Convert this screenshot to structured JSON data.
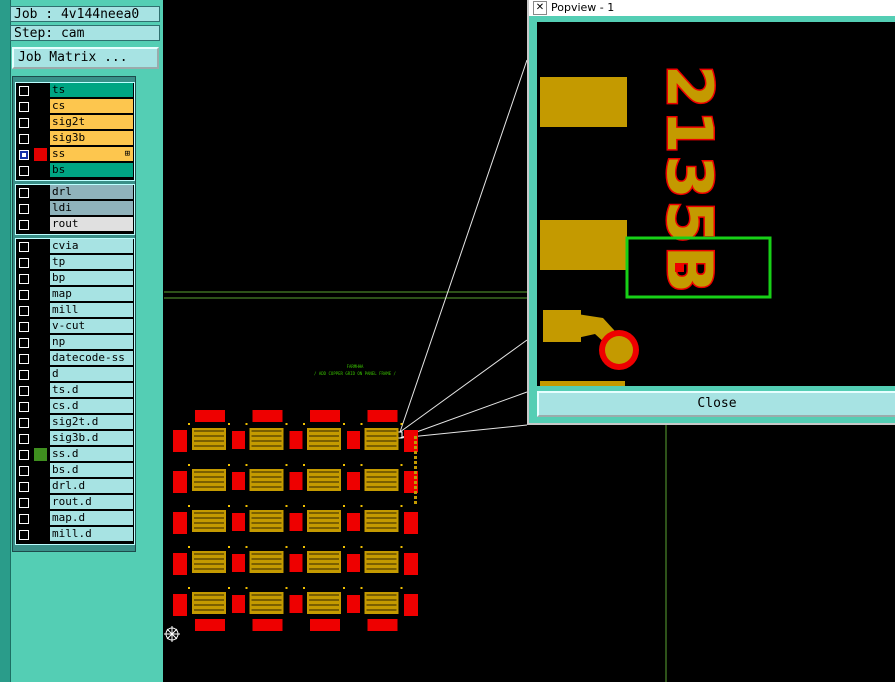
{
  "job_label": "Job : 4v144neea0",
  "step_label": "Step: cam",
  "job_matrix_button": "Job Matrix ...",
  "colors": {
    "panel": "#54ceb4",
    "row_bg": "#a7e3e3",
    "signal": "#fdc64e",
    "solder": "#00a583",
    "drill": "#8fb2bb",
    "selected_color": "#e40000",
    "copper": "#c49a00",
    "pad_red": "#ee0000",
    "green_box": "#17d017"
  },
  "layer_groups": [
    {
      "layers": [
        {
          "name": "ts",
          "type": "solder",
          "swatch": "",
          "checked": false
        },
        {
          "name": "cs",
          "type": "signal",
          "swatch": "",
          "checked": false
        },
        {
          "name": "sig2t",
          "type": "signal",
          "swatch": "",
          "checked": false
        },
        {
          "name": "sig3b",
          "type": "signal",
          "swatch": "",
          "checked": false
        },
        {
          "name": "ss",
          "type": "signal",
          "swatch": "#e40000",
          "checked": true,
          "marker": "⊞"
        },
        {
          "name": "bs",
          "type": "solder",
          "swatch": "",
          "checked": false
        }
      ]
    },
    {
      "layers": [
        {
          "name": "drl",
          "type": "drill",
          "swatch": "",
          "checked": false
        },
        {
          "name": "ldi",
          "type": "drill",
          "swatch": "",
          "checked": false
        },
        {
          "name": "rout",
          "type": "rout",
          "swatch": "",
          "checked": false
        }
      ]
    },
    {
      "layers": [
        {
          "name": "cvia",
          "type": "misc",
          "swatch": "",
          "checked": false
        },
        {
          "name": "tp",
          "type": "misc",
          "swatch": "",
          "checked": false
        },
        {
          "name": "bp",
          "type": "misc",
          "swatch": "",
          "checked": false
        },
        {
          "name": "map",
          "type": "misc",
          "swatch": "",
          "checked": false
        },
        {
          "name": "mill",
          "type": "misc",
          "swatch": "",
          "checked": false
        },
        {
          "name": "v-cut",
          "type": "misc",
          "swatch": "",
          "checked": false
        },
        {
          "name": "np",
          "type": "misc",
          "swatch": "",
          "checked": false
        },
        {
          "name": "datecode-ss",
          "type": "misc",
          "swatch": "",
          "checked": false
        },
        {
          "name": "d",
          "type": "misc",
          "swatch": "",
          "checked": false
        },
        {
          "name": "ts.d",
          "type": "misc",
          "swatch": "",
          "checked": false
        },
        {
          "name": "cs.d",
          "type": "misc",
          "swatch": "",
          "checked": false
        },
        {
          "name": "sig2t.d",
          "type": "misc",
          "swatch": "",
          "checked": false
        },
        {
          "name": "sig3b.d",
          "type": "misc",
          "swatch": "",
          "checked": false
        },
        {
          "name": "ss.d",
          "type": "misc",
          "swatch": "#3f8f1f",
          "checked": false
        },
        {
          "name": "bs.d",
          "type": "misc",
          "swatch": "",
          "checked": false
        },
        {
          "name": "drl.d",
          "type": "misc",
          "swatch": "",
          "checked": false
        },
        {
          "name": "rout.d",
          "type": "misc",
          "swatch": "",
          "checked": false
        },
        {
          "name": "map.d",
          "type": "misc",
          "swatch": "",
          "checked": false
        },
        {
          "name": "mill.d",
          "type": "misc",
          "swatch": "",
          "checked": false
        }
      ]
    }
  ],
  "canvas": {
    "panel_text_1": "FARMHHA",
    "panel_text_2": "/ ADD COPPER GRID ON PANEL FRAME /",
    "origin_icon": "crosshair-origin-icon"
  },
  "popview": {
    "title": "Popview - 1",
    "title_icon": "x-window-icon",
    "silkscreen_text": "2135B",
    "close_label": "Close"
  }
}
